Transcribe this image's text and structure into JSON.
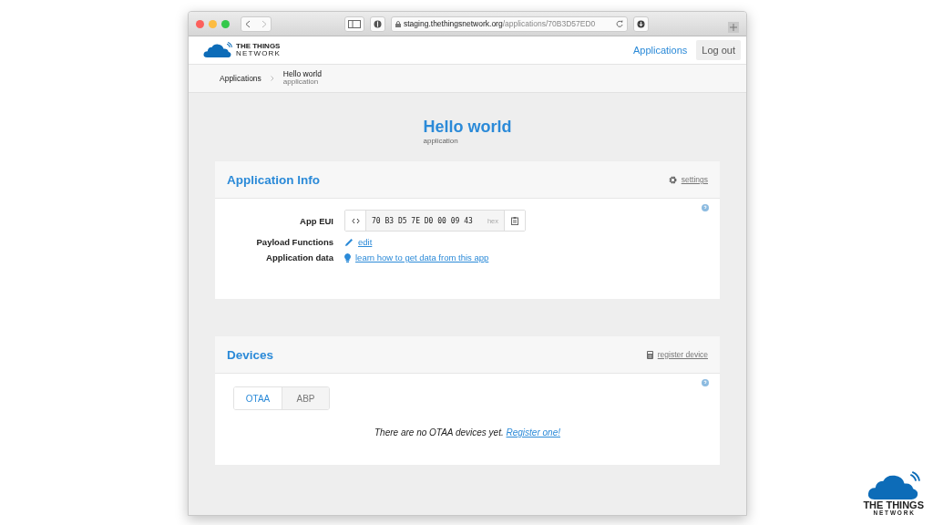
{
  "browser": {
    "url_host": "staging.thethingsnetwork.org",
    "url_path": "/applications/70B3D57ED0"
  },
  "header": {
    "logo": {
      "line1": "THE THINGS",
      "line2": "N E T W O R K"
    },
    "nav": [
      {
        "label": "Applications",
        "kind": "link"
      },
      {
        "label": "Log out",
        "kind": "button"
      }
    ]
  },
  "breadcrumb": {
    "parent": "Applications",
    "current": "Hello world",
    "current_sub": "application"
  },
  "page": {
    "title": "Hello world",
    "subtitle": "application"
  },
  "app_info": {
    "title": "Application Info",
    "action": "settings",
    "rows": [
      {
        "label": "App EUI",
        "kind": "eui",
        "value": "70 B3 D5 7E D0 00 09 43",
        "suffix": "hex"
      },
      {
        "label": "Payload Functions",
        "kind": "edit",
        "value": "edit"
      },
      {
        "label": "Application data",
        "kind": "tip",
        "value": "learn how to get data from this app"
      }
    ]
  },
  "devices": {
    "title": "Devices",
    "action": "register device",
    "tabs": [
      {
        "label": "OTAA",
        "selected": true
      },
      {
        "label": "ABP",
        "selected": false
      }
    ],
    "empty_text": "There are no OTAA devices yet. ",
    "empty_link": "Register one!"
  },
  "corner_logo": {
    "line1": "THE THINGS",
    "line2": "N E T W O R K"
  }
}
